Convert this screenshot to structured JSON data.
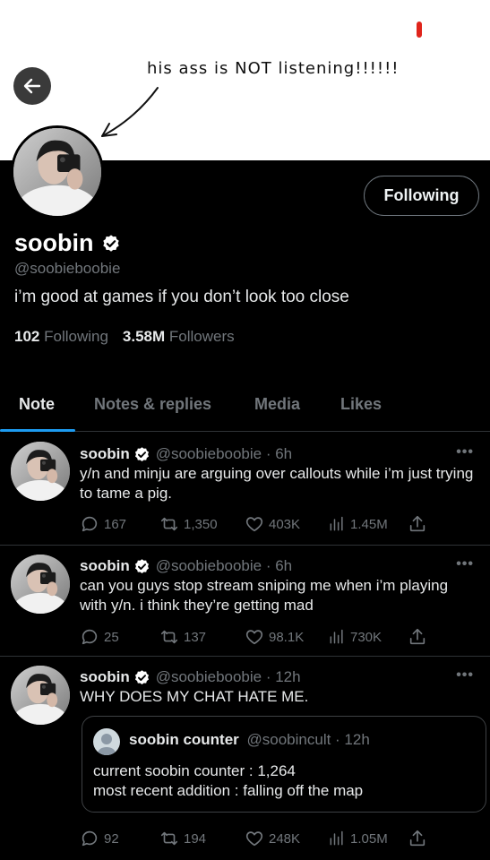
{
  "annotation": "his ass is NOT listening!!!!!!",
  "profile": {
    "name": "soobin",
    "handle": "@soobieboobie",
    "bio": "i’m good at games if you don’t look too close",
    "following_count": "102",
    "following_label": "Following",
    "followers_count": "3.58M",
    "followers_label": "Followers",
    "follow_button": "Following"
  },
  "tabs": [
    "Note",
    "Notes & replies",
    "Media",
    "Likes"
  ],
  "tweets": [
    {
      "name": "soobin",
      "handle_time": "@soobieboobie · 6h",
      "text": "y/n and minju are arguing over callouts while i’m just trying to tame a pig.",
      "replies": "167",
      "retweets": "1,350",
      "likes": "403K",
      "views": "1.45M"
    },
    {
      "name": "soobin",
      "handle_time": "@soobieboobie · 6h",
      "text": "can you guys stop stream sniping me when i’m playing with y/n. i think they’re getting mad",
      "replies": "25",
      "retweets": "137",
      "likes": "98.1K",
      "views": "730K"
    },
    {
      "name": "soobin",
      "handle_time": "@soobieboobie · 12h",
      "text": "WHY DOES MY CHAT HATE ME.",
      "quote": {
        "name": "soobin counter",
        "handle_time": "@soobincult · 12h",
        "line1": "current soobin counter : 1,264",
        "line2": "most recent addition : falling off the map"
      },
      "replies": "92",
      "retweets": "194",
      "likes": "248K",
      "views": "1.05M"
    }
  ],
  "more_glyph": "•••",
  "colors": {
    "accent": "#1d9bf0",
    "muted": "#71767b",
    "divider": "#2f3336",
    "annotation_mark": "#e0241b"
  },
  "icons": [
    "back-arrow-icon",
    "verified-badge-icon",
    "reply-icon",
    "retweet-icon",
    "like-icon",
    "views-icon",
    "share-icon",
    "more-icon"
  ]
}
